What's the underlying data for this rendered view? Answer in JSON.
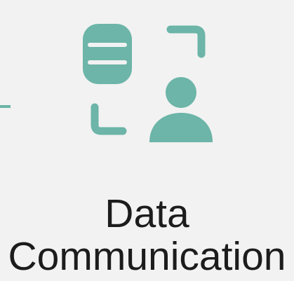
{
  "card": {
    "title_line_1": "Data",
    "title_line_2": "Communication",
    "icon": "database-user-exchange-icon"
  },
  "colors": {
    "background": "#f2f2f2",
    "accent": "#6cb5a8",
    "text": "#1c1c1c"
  }
}
